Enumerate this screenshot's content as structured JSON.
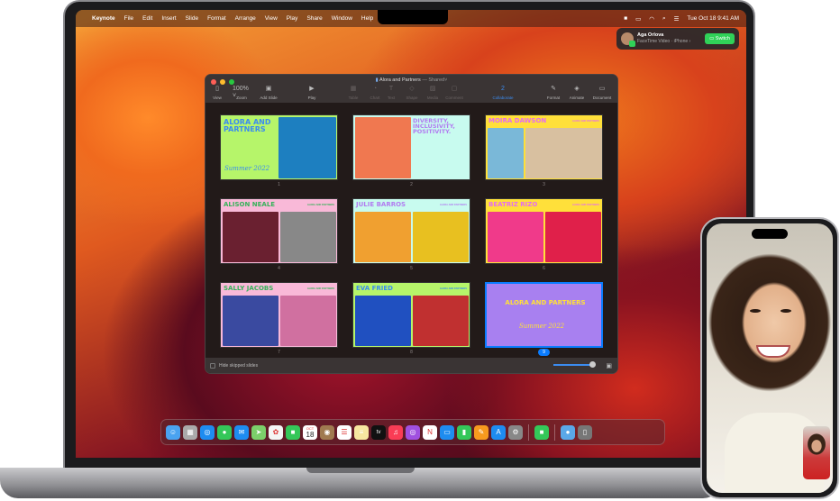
{
  "menubar": {
    "app": "Keynote",
    "items": [
      "File",
      "Edit",
      "Insert",
      "Slide",
      "Format",
      "Arrange",
      "View",
      "Play",
      "Share",
      "Window",
      "Help"
    ],
    "clock": "Tue Oct 18  9:41 AM"
  },
  "notification": {
    "name": "Aga Orlova",
    "subtitle": "FaceTime Video · iPhone ›",
    "button": "Switch"
  },
  "window": {
    "title": "Alora and Partners",
    "status": "— Shared˅",
    "toolbar": [
      {
        "icon": "sidebar-icon",
        "label": "View"
      },
      {
        "icon": "zoom-select",
        "label": "Zoom",
        "value": "100% ˅"
      },
      {
        "icon": "add-slide-icon",
        "label": "Add Slide"
      },
      {
        "icon": "play-icon",
        "label": "Play"
      },
      {
        "icon": "table-icon",
        "label": "Table"
      },
      {
        "icon": "chart-icon",
        "label": "Chart"
      },
      {
        "icon": "text-icon",
        "label": "Text"
      },
      {
        "icon": "shape-icon",
        "label": "Shape"
      },
      {
        "icon": "media-icon",
        "label": "Media"
      },
      {
        "icon": "comment-icon",
        "label": "Comment"
      },
      {
        "icon": "collaborate-icon",
        "label": "Collaborate",
        "value": "2"
      },
      {
        "icon": "format-icon",
        "label": "Format"
      },
      {
        "icon": "animate-icon",
        "label": "Animate"
      },
      {
        "icon": "document-icon",
        "label": "Document"
      }
    ],
    "slides": [
      {
        "num": "1",
        "title": "ALORA AND PARTNERS",
        "script": "Summer 2022",
        "bg": "#b6f56a",
        "color": "#3a8cf0"
      },
      {
        "num": "2",
        "title": "DIVERSITY, INCLUSIVITY, POSITIVITY.",
        "bg": "#c8fbef",
        "color": "#b27cf0"
      },
      {
        "num": "3",
        "title": "MOIRA DAWSON",
        "tag": "ALORA AND PARTNERS",
        "bg": "#ffe03a",
        "color": "#e46cf0"
      },
      {
        "num": "4",
        "title": "ALISON NEALE",
        "tag": "ALORA AND PARTNERS",
        "bg": "#f9b9d8",
        "color": "#36b25a"
      },
      {
        "num": "5",
        "title": "JULIE BARROS",
        "tag": "ALORA AND PARTNERS",
        "bg": "#c8fbef",
        "color": "#b27cf0"
      },
      {
        "num": "6",
        "title": "BEATRIZ RIZO",
        "tag": "ALORA AND PARTNERS",
        "bg": "#ffe03a",
        "color": "#e46cf0"
      },
      {
        "num": "7",
        "title": "SALLY JACOBS",
        "tag": "ALORA AND PARTNERS",
        "bg": "#f9b9d8",
        "color": "#36b25a"
      },
      {
        "num": "8",
        "title": "EVA FRIED",
        "tag": "ALORA AND PARTNERS",
        "bg": "#b6f56a",
        "color": "#3a8cf0"
      },
      {
        "num": "9",
        "title": "ALORA AND PARTNERS",
        "script": "Summer 2022",
        "bg": "#a880f0",
        "color": "#ffe03a",
        "selected": true
      }
    ],
    "footer": {
      "hide_skipped": "Hide skipped slides"
    }
  },
  "dock": [
    "finder",
    "launchpad",
    "safari",
    "messages",
    "mail",
    "maps",
    "photos",
    "facetime",
    "calendar",
    "contacts",
    "reminders",
    "notes",
    "tv",
    "music",
    "podcasts",
    "news",
    "keynote",
    "numbers",
    "pages",
    "app-store",
    "system-settings",
    "facetime-active",
    "downloads",
    "trash"
  ],
  "dock_calendar": {
    "month": "OCT",
    "day": "18"
  },
  "dock_tv": "tv"
}
